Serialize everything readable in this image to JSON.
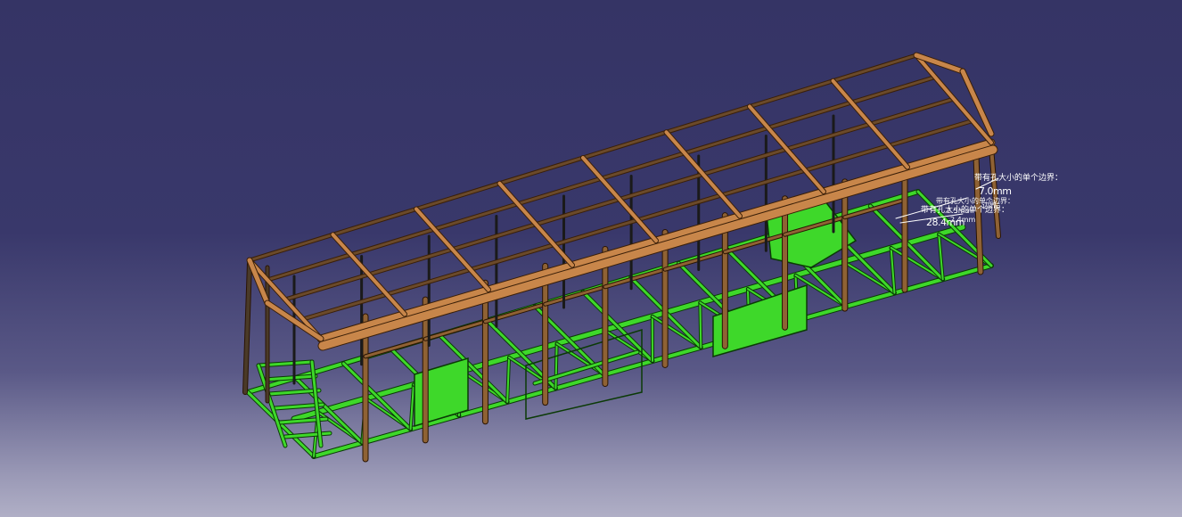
{
  "viewer": {
    "model": "bus-body-frame",
    "colors": {
      "background_top": "#353465",
      "background_bottom": "#b0afc6",
      "roof_structure": "#c8864a",
      "roof_outline": "#3a1f08",
      "chassis": "#3ed82a",
      "chassis_outline": "#0b3a06",
      "pillars": "#8f6234",
      "annotation_text": "#ffffff"
    }
  },
  "annotations": {
    "note_1_label": "带有孔大小的单个边界：",
    "note_1_value": "7.0mm",
    "note_2_label": "带有孔大小的单个边界：",
    "note_2_value": "28.4mm",
    "overlap_text_a": "带有孔大小的单个边界：",
    "overlap_text_b": "边界：",
    "overlap_value_a": "2.5mm",
    "overlap_value_b": "2.4mm"
  }
}
